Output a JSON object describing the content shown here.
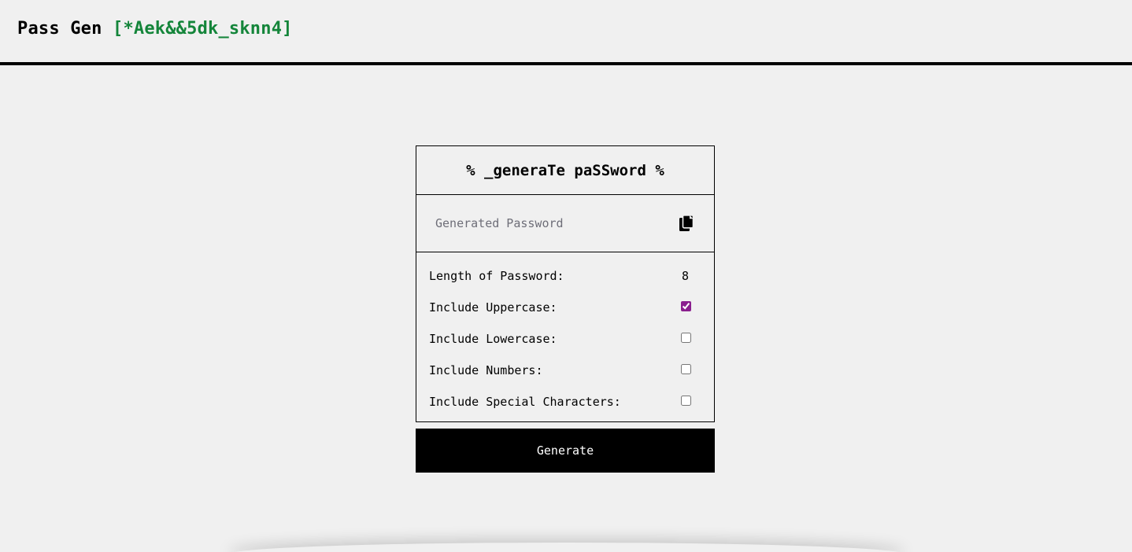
{
  "header": {
    "title": "Pass Gen",
    "tagline": "[*Aek&&5dk_sknn4]",
    "accent_color": "#14853a"
  },
  "card": {
    "title": "% _generaTe paSSword %",
    "password_placeholder": "Generated Password",
    "copy_icon": "copy-icon",
    "options": [
      {
        "label": "Length of Password:",
        "value": "8"
      },
      {
        "label": "Include Uppercase:",
        "checked": true
      },
      {
        "label": "Include Lowercase:",
        "checked": false
      },
      {
        "label": "Include Numbers:",
        "checked": false
      },
      {
        "label": "Include Special Characters:",
        "checked": false
      }
    ]
  },
  "generate_label": "Generate",
  "checkbox_accent": "#8a1f8e"
}
